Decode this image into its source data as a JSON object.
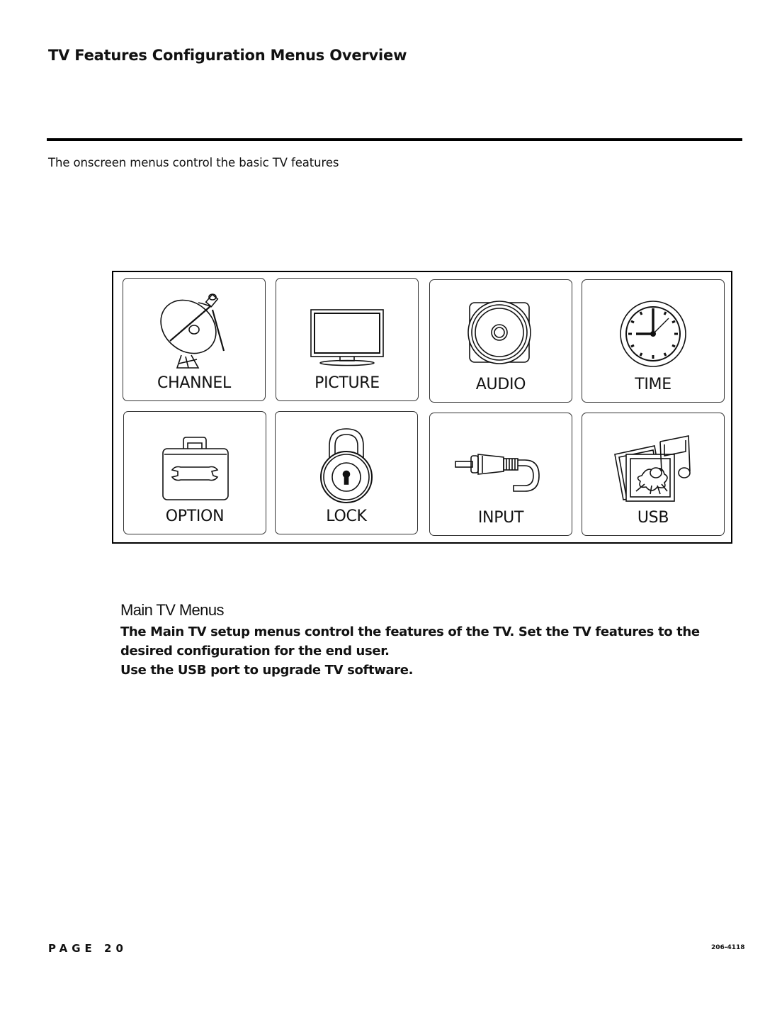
{
  "header": {
    "title": "TV Features Configuration Menus Overview",
    "intro": "The onscreen menus control the basic TV features"
  },
  "menu_panel": {
    "tiles": [
      {
        "label": "CHANNEL",
        "icon": "satellite-dish-icon"
      },
      {
        "label": "PICTURE",
        "icon": "tv-monitor-icon"
      },
      {
        "label": "AUDIO",
        "icon": "speaker-icon"
      },
      {
        "label": "TIME",
        "icon": "clock-icon"
      },
      {
        "label": "OPTION",
        "icon": "toolbox-wrench-icon"
      },
      {
        "label": "LOCK",
        "icon": "padlock-icon"
      },
      {
        "label": "INPUT",
        "icon": "rca-cable-icon"
      },
      {
        "label": "USB",
        "icon": "photo-music-icon"
      }
    ]
  },
  "section": {
    "heading": "Main TV Menus",
    "paragraphs": [
      "The Main TV setup menus control the features of the TV. Set the TV features to the desired configuration for the end user.",
      "Use the USB port to upgrade TV software."
    ]
  },
  "footer": {
    "page_label": "PAGE 20",
    "doc_code": "206-4118"
  }
}
